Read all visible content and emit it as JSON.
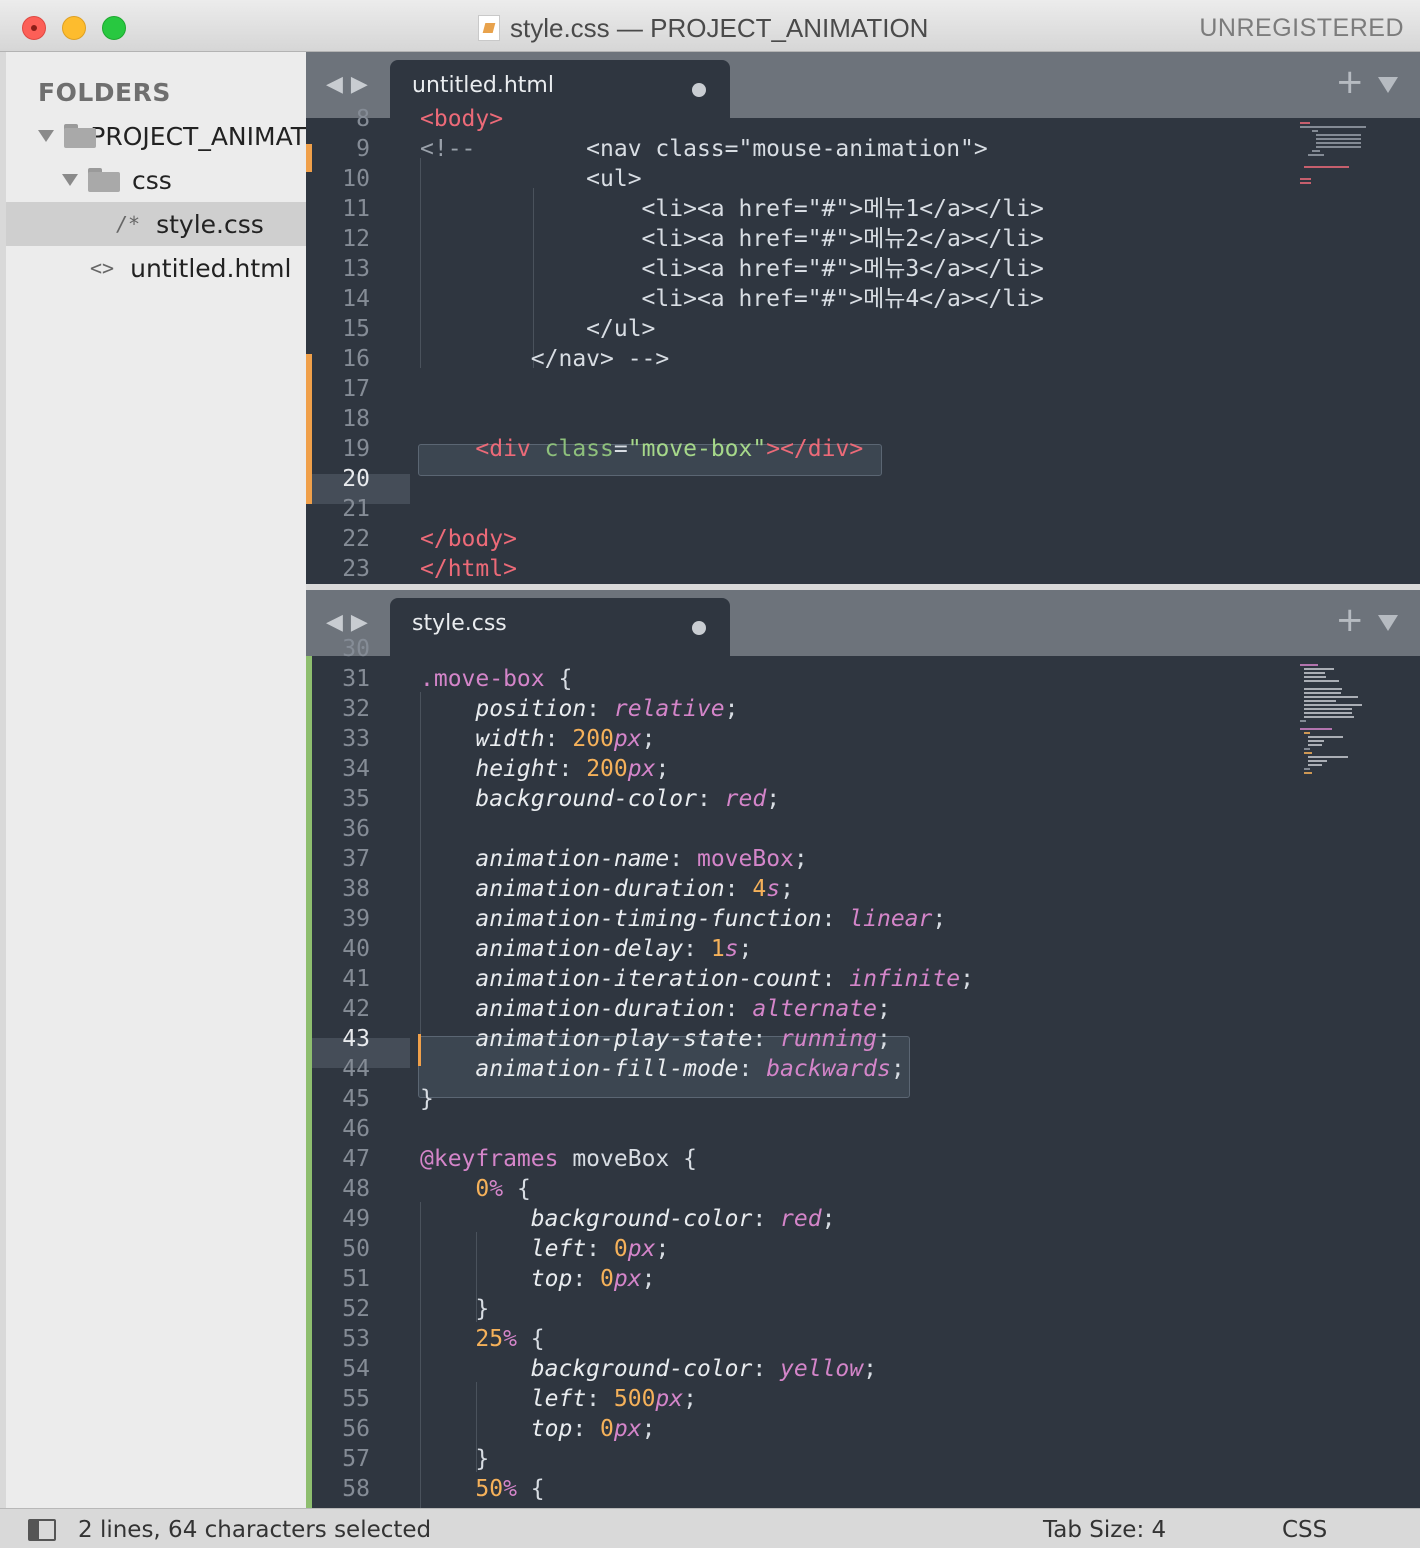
{
  "window": {
    "title": "style.css — PROJECT_ANIMATION",
    "registration": "UNREGISTERED"
  },
  "sidebar": {
    "heading": "FOLDERS",
    "project": "PROJECT_ANIMAT",
    "folder": "css",
    "files": [
      {
        "glyph": "/*",
        "name": "style.css"
      },
      {
        "glyph": "<>",
        "name": "untitled.html"
      }
    ]
  },
  "top_pane": {
    "tab_label": "untitled.html",
    "active_line": 20
  },
  "bottom_pane": {
    "tab_label": "style.css",
    "active_line": 43
  },
  "status": {
    "selection": "2 lines, 64 characters selected",
    "tab_size": "Tab Size: 4",
    "syntax": "CSS"
  },
  "icons": [
    "close-icon",
    "minimize-icon",
    "zoom-icon",
    "file-icon",
    "disclosure-triangle-icon",
    "folder-icon",
    "nav-back-icon",
    "nav-forward-icon",
    "add-tab-icon",
    "tab-menu-icon",
    "panel-toggle-icon"
  ],
  "colors": {
    "editor_bg": "#2f3640",
    "tab_bar": "#6d737b",
    "sidebar_bg": "#ececec",
    "modified_marker": "#f0a04a",
    "added_marker": "#8ebe6f",
    "tag": "#ec6a78",
    "string": "#a6d88a",
    "keyword": "#d485c9",
    "number": "#f5b15a"
  },
  "html_code": [
    {
      "n": "8",
      "tokens": [
        [
          "tag",
          "<body>"
        ]
      ]
    },
    {
      "n": "9",
      "tokens": [
        [
          "comm",
          "<!--"
        ],
        [
          "plain",
          "        <nav class=\"mouse-animation\">"
        ]
      ]
    },
    {
      "n": "10",
      "tokens": [
        [
          "plain",
          "            <ul>"
        ]
      ]
    },
    {
      "n": "11",
      "tokens": [
        [
          "plain",
          "                <li><a href=\"#\">메뉴1</a></li>"
        ]
      ]
    },
    {
      "n": "12",
      "tokens": [
        [
          "plain",
          "                <li><a href=\"#\">메뉴2</a></li>"
        ]
      ]
    },
    {
      "n": "13",
      "tokens": [
        [
          "plain",
          "                <li><a href=\"#\">메뉴3</a></li>"
        ]
      ]
    },
    {
      "n": "14",
      "tokens": [
        [
          "plain",
          "                <li><a href=\"#\">메뉴4</a></li>"
        ]
      ]
    },
    {
      "n": "15",
      "tokens": [
        [
          "plain",
          "            </ul>"
        ]
      ]
    },
    {
      "n": "16",
      "tokens": [
        [
          "plain",
          "        </nav> -->"
        ]
      ]
    },
    {
      "n": "17",
      "tokens": []
    },
    {
      "n": "18",
      "tokens": []
    },
    {
      "n": "19",
      "tokens": [
        [
          "plain",
          "    "
        ],
        [
          "tag",
          "<div"
        ],
        [
          "plain",
          " "
        ],
        [
          "attr",
          "class"
        ],
        [
          "plain",
          "="
        ],
        [
          "str",
          "\"move-box\""
        ],
        [
          "tag",
          "></div>"
        ]
      ]
    },
    {
      "n": "20",
      "tokens": []
    },
    {
      "n": "21",
      "tokens": []
    },
    {
      "n": "22",
      "tokens": [
        [
          "tag",
          "</body>"
        ]
      ]
    },
    {
      "n": "23",
      "tokens": [
        [
          "tag",
          "</html>"
        ]
      ]
    }
  ],
  "css_code": [
    {
      "n": "30",
      "tokens": []
    },
    {
      "n": "31",
      "tokens": [
        [
          "sel",
          ".move-box"
        ],
        [
          "plain",
          " {"
        ]
      ]
    },
    {
      "n": "32",
      "tokens": [
        [
          "plain",
          "    "
        ],
        [
          "prop",
          "position"
        ],
        [
          "plain",
          ": "
        ],
        [
          "kw",
          "relative"
        ],
        [
          "plain",
          ";"
        ]
      ]
    },
    {
      "n": "33",
      "tokens": [
        [
          "plain",
          "    "
        ],
        [
          "prop",
          "width"
        ],
        [
          "plain",
          ": "
        ],
        [
          "num",
          "200"
        ],
        [
          "unit",
          "px"
        ],
        [
          "plain",
          ";"
        ]
      ]
    },
    {
      "n": "34",
      "tokens": [
        [
          "plain",
          "    "
        ],
        [
          "prop",
          "height"
        ],
        [
          "plain",
          ": "
        ],
        [
          "num",
          "200"
        ],
        [
          "unit",
          "px"
        ],
        [
          "plain",
          ";"
        ]
      ]
    },
    {
      "n": "35",
      "tokens": [
        [
          "plain",
          "    "
        ],
        [
          "prop",
          "background-color"
        ],
        [
          "plain",
          ": "
        ],
        [
          "kw",
          "red"
        ],
        [
          "plain",
          ";"
        ]
      ]
    },
    {
      "n": "36",
      "tokens": []
    },
    {
      "n": "37",
      "tokens": [
        [
          "plain",
          "    "
        ],
        [
          "prop",
          "animation-name"
        ],
        [
          "plain",
          ": "
        ],
        [
          "sel",
          "moveBox"
        ],
        [
          "plain",
          ";"
        ]
      ]
    },
    {
      "n": "38",
      "tokens": [
        [
          "plain",
          "    "
        ],
        [
          "prop",
          "animation-duration"
        ],
        [
          "plain",
          ": "
        ],
        [
          "num",
          "4"
        ],
        [
          "unit",
          "s"
        ],
        [
          "plain",
          ";"
        ]
      ]
    },
    {
      "n": "39",
      "tokens": [
        [
          "plain",
          "    "
        ],
        [
          "prop",
          "animation-timing-function"
        ],
        [
          "plain",
          ": "
        ],
        [
          "kw",
          "linear"
        ],
        [
          "plain",
          ";"
        ]
      ]
    },
    {
      "n": "40",
      "tokens": [
        [
          "plain",
          "    "
        ],
        [
          "prop",
          "animation-delay"
        ],
        [
          "plain",
          ": "
        ],
        [
          "num",
          "1"
        ],
        [
          "unit",
          "s"
        ],
        [
          "plain",
          ";"
        ]
      ]
    },
    {
      "n": "41",
      "tokens": [
        [
          "plain",
          "    "
        ],
        [
          "prop",
          "animation-iteration-count"
        ],
        [
          "plain",
          ": "
        ],
        [
          "kw",
          "infinite"
        ],
        [
          "plain",
          ";"
        ]
      ]
    },
    {
      "n": "42",
      "tokens": [
        [
          "plain",
          "    "
        ],
        [
          "prop",
          "animation-duration"
        ],
        [
          "plain",
          ": "
        ],
        [
          "kw",
          "alternate"
        ],
        [
          "plain",
          ";"
        ]
      ]
    },
    {
      "n": "43",
      "tokens": [
        [
          "plain",
          "    "
        ],
        [
          "prop",
          "animation-play-state"
        ],
        [
          "plain",
          ": "
        ],
        [
          "kw",
          "running"
        ],
        [
          "plain",
          ";"
        ]
      ]
    },
    {
      "n": "44",
      "tokens": [
        [
          "plain",
          "    "
        ],
        [
          "prop",
          "animation-fill-mode"
        ],
        [
          "plain",
          ": "
        ],
        [
          "kw",
          "backwards"
        ],
        [
          "plain",
          ";"
        ]
      ]
    },
    {
      "n": "45",
      "tokens": [
        [
          "plain",
          "}"
        ]
      ]
    },
    {
      "n": "46",
      "tokens": []
    },
    {
      "n": "47",
      "tokens": [
        [
          "sel",
          "@keyframes"
        ],
        [
          "plain",
          " moveBox {"
        ]
      ]
    },
    {
      "n": "48",
      "tokens": [
        [
          "plain",
          "    "
        ],
        [
          "num",
          "0"
        ],
        [
          "unit",
          "%"
        ],
        [
          "plain",
          " {"
        ]
      ]
    },
    {
      "n": "49",
      "tokens": [
        [
          "plain",
          "        "
        ],
        [
          "prop",
          "background-color"
        ],
        [
          "plain",
          ": "
        ],
        [
          "kw",
          "red"
        ],
        [
          "plain",
          ";"
        ]
      ]
    },
    {
      "n": "50",
      "tokens": [
        [
          "plain",
          "        "
        ],
        [
          "prop",
          "left"
        ],
        [
          "plain",
          ": "
        ],
        [
          "num",
          "0"
        ],
        [
          "unit",
          "px"
        ],
        [
          "plain",
          ";"
        ]
      ]
    },
    {
      "n": "51",
      "tokens": [
        [
          "plain",
          "        "
        ],
        [
          "prop",
          "top"
        ],
        [
          "plain",
          ": "
        ],
        [
          "num",
          "0"
        ],
        [
          "unit",
          "px"
        ],
        [
          "plain",
          ";"
        ]
      ]
    },
    {
      "n": "52",
      "tokens": [
        [
          "plain",
          "    }"
        ]
      ]
    },
    {
      "n": "53",
      "tokens": [
        [
          "plain",
          "    "
        ],
        [
          "num",
          "25"
        ],
        [
          "unit",
          "%"
        ],
        [
          "plain",
          " {"
        ]
      ]
    },
    {
      "n": "54",
      "tokens": [
        [
          "plain",
          "        "
        ],
        [
          "prop",
          "background-color"
        ],
        [
          "plain",
          ": "
        ],
        [
          "kw",
          "yellow"
        ],
        [
          "plain",
          ";"
        ]
      ]
    },
    {
      "n": "55",
      "tokens": [
        [
          "plain",
          "        "
        ],
        [
          "prop",
          "left"
        ],
        [
          "plain",
          ": "
        ],
        [
          "num",
          "500"
        ],
        [
          "unit",
          "px"
        ],
        [
          "plain",
          ";"
        ]
      ]
    },
    {
      "n": "56",
      "tokens": [
        [
          "plain",
          "        "
        ],
        [
          "prop",
          "top"
        ],
        [
          "plain",
          ": "
        ],
        [
          "num",
          "0"
        ],
        [
          "unit",
          "px"
        ],
        [
          "plain",
          ";"
        ]
      ]
    },
    {
      "n": "57",
      "tokens": [
        [
          "plain",
          "    }"
        ]
      ]
    },
    {
      "n": "58",
      "tokens": [
        [
          "plain",
          "    "
        ],
        [
          "num",
          "50"
        ],
        [
          "unit",
          "%"
        ],
        [
          "plain",
          " {"
        ]
      ]
    }
  ]
}
